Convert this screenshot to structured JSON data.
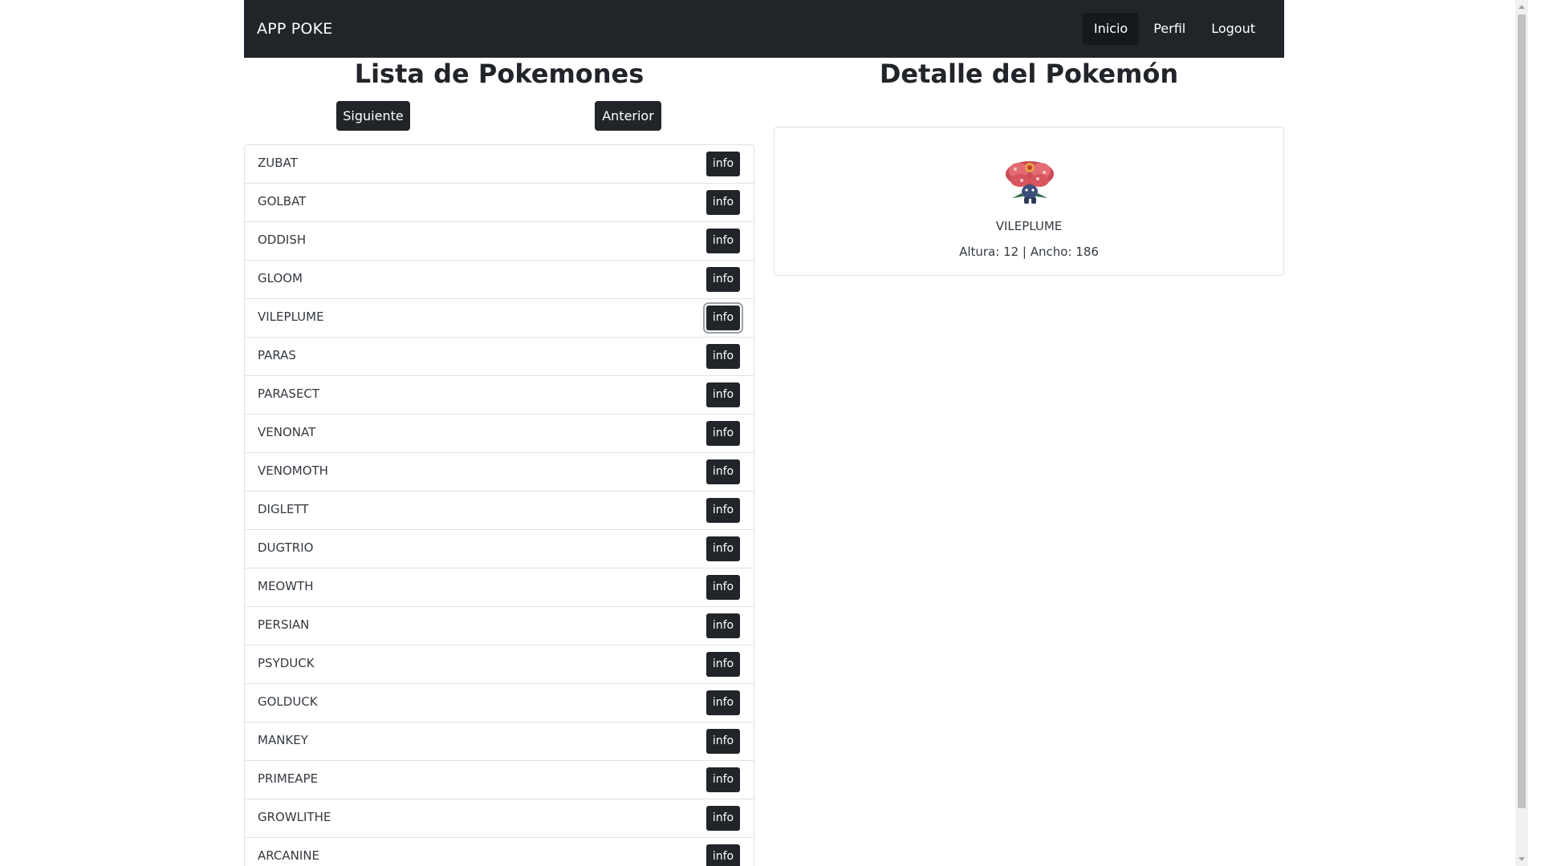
{
  "navbar": {
    "brand": "APP POKE",
    "links": [
      {
        "label": "Inicio",
        "active": true
      },
      {
        "label": "Perfil",
        "active": false
      },
      {
        "label": "Logout",
        "active": false
      }
    ]
  },
  "list": {
    "title": "Lista de Pokemones",
    "next_label": "Siguiente",
    "prev_label": "Anterior",
    "info_label": "info",
    "items": [
      "ZUBAT",
      "GOLBAT",
      "ODDISH",
      "GLOOM",
      "VILEPLUME",
      "PARAS",
      "PARASECT",
      "VENONAT",
      "VENOMOTH",
      "DIGLETT",
      "DUGTRIO",
      "MEOWTH",
      "PERSIAN",
      "PSYDUCK",
      "GOLDUCK",
      "MANKEY",
      "PRIMEAPE",
      "GROWLITHE",
      "ARCANINE"
    ],
    "focused_item": "VILEPLUME"
  },
  "detail": {
    "title": "Detalle del Pokemón",
    "name": "VILEPLUME",
    "stats": "Altura: 12 | Ancho: 186",
    "sprite_icon": "vileplume-sprite-icon"
  },
  "colors": {
    "dark": "#212529",
    "border": "#dee2e6",
    "background": "#ffffff"
  }
}
